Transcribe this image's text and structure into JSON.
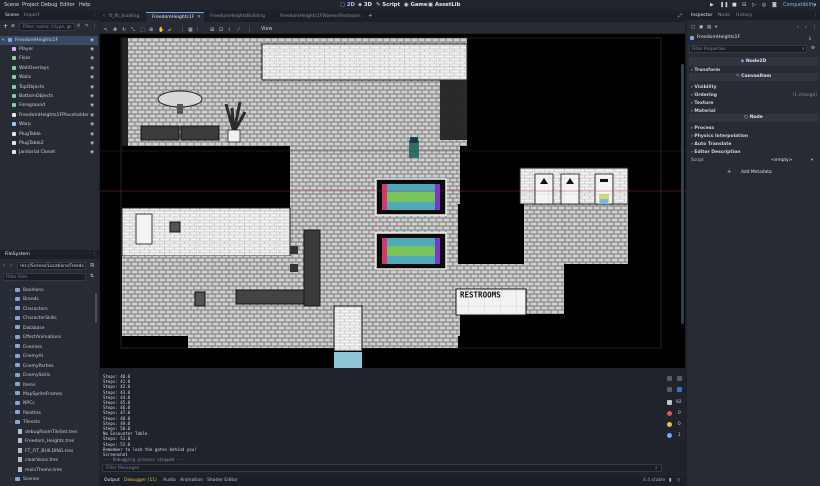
{
  "menu": [
    "Scene",
    "Project",
    "Debug",
    "Editor",
    "Help"
  ],
  "workspaces": [
    "2D",
    "3D",
    "Script",
    "Game",
    "AssetLib"
  ],
  "renderer": "Compatibility",
  "scene_dock": {
    "tabs": [
      "Scene",
      "Import"
    ],
    "filter_placeholder": "Filter: name, t:type, g",
    "root": "FreedomHeights1F",
    "nodes": [
      "Player",
      "Floor",
      "WallOverlays",
      "Walls",
      "TopObjects",
      "BottomObjects",
      "Foreground",
      "FreedomHeights1FPlaceholder",
      "Warp",
      "PlugTable",
      "PlugTable2",
      "Janitorial Closet"
    ]
  },
  "filesystem": {
    "title": "FileSystem",
    "path": "res://Scenes/Locations/Freedo",
    "filter_placeholder": "Filter Files",
    "items": [
      {
        "label": "Booleans",
        "kind": "folder"
      },
      {
        "label": "Brands",
        "kind": "folder"
      },
      {
        "label": "Characters",
        "kind": "folder"
      },
      {
        "label": "CharacterSkills",
        "kind": "folder"
      },
      {
        "label": "Database",
        "kind": "folder"
      },
      {
        "label": "EffectAnimations",
        "kind": "folder"
      },
      {
        "label": "Enemies",
        "kind": "folder"
      },
      {
        "label": "EnemyAI",
        "kind": "folder"
      },
      {
        "label": "EnemyParties",
        "kind": "folder"
      },
      {
        "label": "EnemySkills",
        "kind": "folder"
      },
      {
        "label": "Items",
        "kind": "folder"
      },
      {
        "label": "MapSpriteFrames",
        "kind": "folder"
      },
      {
        "label": "NPCs",
        "kind": "folder"
      },
      {
        "label": "Palettes",
        "kind": "folder"
      },
      {
        "label": "Tilesets",
        "kind": "folder"
      },
      {
        "label": "debugRoomTileSet.tres",
        "kind": "file"
      },
      {
        "label": "Freedom_Heights.tres",
        "kind": "file"
      },
      {
        "label": "FT_FIT_BUILDING.tres",
        "kind": "file"
      },
      {
        "label": "clearVoice.tres",
        "kind": "file"
      },
      {
        "label": "mainTheme.tres",
        "kind": "file"
      },
      {
        "label": "Scenes",
        "kind": "folder"
      }
    ]
  },
  "editor_tabs": [
    "ft_fit_building",
    "FreedomHeights1F",
    "FreedomHeightsBuilding",
    "FreedomHeights1FWomenRestroom"
  ],
  "viewport_menu": "View",
  "map": {
    "restroom_sign": "RESTROOMS"
  },
  "console": {
    "lines": [
      "Steps: 40.0",
      "Steps: 41.0",
      "Steps: 42.0",
      "Steps: 43.0",
      "Steps: 44.0",
      "Steps: 45.0",
      "Steps: 46.0",
      "Steps: 47.0",
      "Steps: 48.0",
      "Steps: 49.0",
      "Steps: 50.0",
      "No Encounter Table",
      "Steps: 51.0",
      "Steps: 52.0",
      "Remember to lock the gates behind you!",
      "Screenshot",
      "--- Debugging process stopped ---"
    ],
    "filter_placeholder": "Filter Messages",
    "counts": [
      "92",
      "0",
      "0",
      "1"
    ]
  },
  "bottom_tabs": [
    "Output",
    "Debugger (11)",
    "Audio",
    "Animation",
    "Shader Editor"
  ],
  "version": "4.4.stable",
  "inspector": {
    "tabs": [
      "Inspector",
      "Node",
      "History"
    ],
    "node_name": "FreedomHeights1F",
    "filter_placeholder": "Filter Properties",
    "class_header": "Node2D",
    "sections": [
      "Transform"
    ],
    "canvasitem_header": "CanvasItem",
    "ci_sections": [
      "Visibility",
      "Ordering",
      "Texture",
      "Material"
    ],
    "ordering_note": "(1 change)",
    "node_header": "Node",
    "node_sections": [
      "Process",
      "Physics Interpolation",
      "Auto Translate",
      "Editor Description"
    ],
    "script_label": "Script",
    "script_value": "<empty>",
    "add_metadata": "Add Metadata"
  },
  "colors": {
    "accent": "#6ea6ff",
    "bg": "#1d2129",
    "panel": "#262b34"
  }
}
